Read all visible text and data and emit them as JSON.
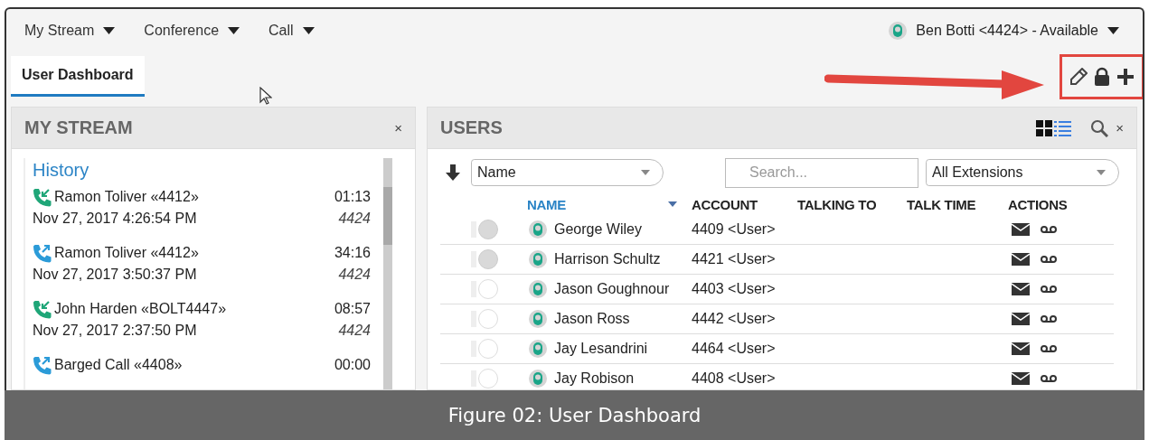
{
  "menu": [
    {
      "label": "My Stream"
    },
    {
      "label": "Conference"
    },
    {
      "label": "Call"
    }
  ],
  "user_status": {
    "label": "Ben Botti <4424> - Available"
  },
  "tabs": [
    {
      "label": "User Dashboard",
      "selected": true
    }
  ],
  "my_stream": {
    "title": "MY STREAM",
    "close": "×",
    "section": "History",
    "calls": [
      {
        "kind": "incoming",
        "name": "Ramon Toliver «4412»",
        "duration": "01:13",
        "date": "Nov 27, 2017 4:26:54 PM",
        "extension": "4424"
      },
      {
        "kind": "outgoing",
        "name": "Ramon Toliver «4412»",
        "duration": "34:16",
        "date": "Nov 27, 2017 3:50:37 PM",
        "extension": "4424"
      },
      {
        "kind": "incoming",
        "name": "John Harden «BOLT4447»",
        "duration": "08:57",
        "date": "Nov 27, 2017 2:37:50 PM",
        "extension": "4424"
      },
      {
        "kind": "outgoing",
        "name": "Barged Call «4408»",
        "duration": "00:00"
      }
    ]
  },
  "users": {
    "title": "USERS",
    "close": "×",
    "sort_field": "Name",
    "search": {
      "placeholder": "Search..."
    },
    "extension_filter": "All Extensions",
    "columns": [
      "NAME",
      "ACCOUNT",
      "TALKING TO",
      "TALK TIME",
      "ACTIONS"
    ],
    "rows": [
      {
        "name": "George Wiley",
        "account": "4409 <User>",
        "selected": true
      },
      {
        "name": "Harrison Schultz",
        "account": "4421 <User>",
        "selected": true
      },
      {
        "name": "Jason Goughnour",
        "account": "4403 <User>",
        "selected": false
      },
      {
        "name": "Jason Ross",
        "account": "4442 <User>",
        "selected": false
      },
      {
        "name": "Jay Lesandrini",
        "account": "4464 <User>",
        "selected": false
      },
      {
        "name": "Jay Robison",
        "account": "4408 <User>",
        "selected": false
      }
    ]
  },
  "caption": "Figure 02: User Dashboard"
}
